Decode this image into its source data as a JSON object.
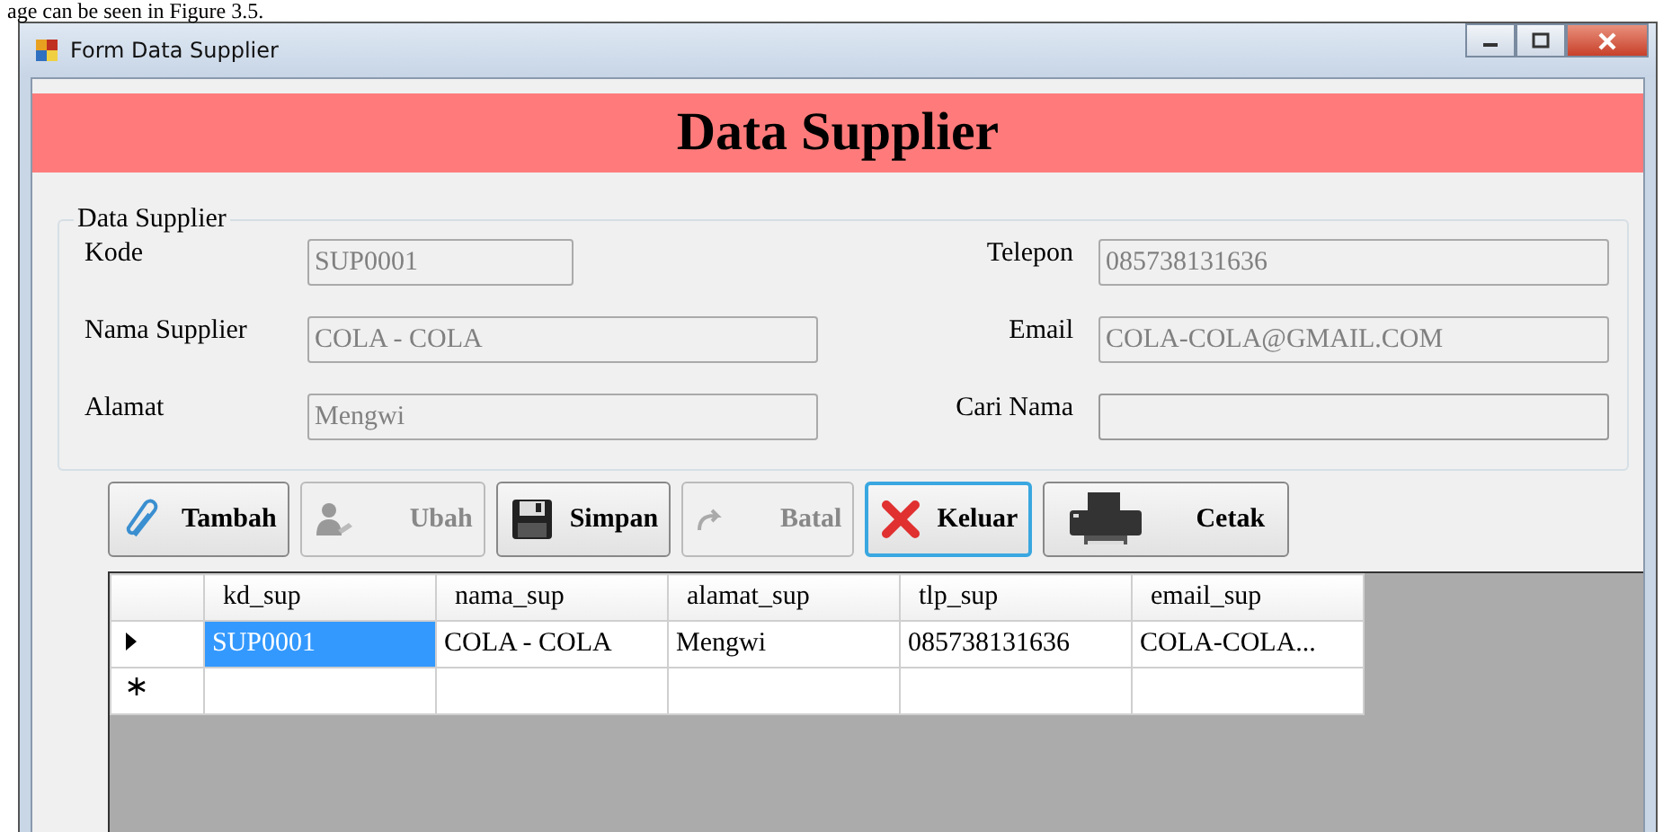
{
  "caption": "age can be seen in Figure 3.5.",
  "window": {
    "title": "Form Data Supplier"
  },
  "banner": {
    "title": "Data Supplier"
  },
  "group": {
    "title": "Data Supplier",
    "left_fields": [
      {
        "label": "Kode",
        "value": "SUP0001",
        "disabled": true
      },
      {
        "label": "Nama Supplier",
        "value": "COLA - COLA",
        "disabled": true
      },
      {
        "label": "Alamat",
        "value": "Mengwi",
        "disabled": true
      }
    ],
    "right_fields": [
      {
        "label": "Telepon",
        "value": "085738131636",
        "disabled": true
      },
      {
        "label": "Email",
        "value": "COLA-COLA@GMAIL.COM",
        "disabled": true
      },
      {
        "label": "Cari Nama",
        "disabled": false
      }
    ]
  },
  "buttons": [
    {
      "kind": "paperclip",
      "label": "Tambah",
      "disabled": false,
      "focused": false
    },
    {
      "kind": "person",
      "label": "Ubah",
      "disabled": true,
      "focused": false
    },
    {
      "kind": "floppy",
      "label": "Simpan",
      "disabled": false,
      "focused": false
    },
    {
      "kind": "arrow",
      "label": "Batal",
      "disabled": true,
      "focused": false
    },
    {
      "kind": "cross",
      "label": "Keluar",
      "disabled": false,
      "focused": true
    },
    {
      "kind": "printer",
      "label": "Cetak",
      "disabled": false,
      "focused": false
    }
  ],
  "grid": {
    "columns": [
      "kd_sup",
      "nama_sup",
      "alamat_sup",
      "tlp_sup",
      "email_sup"
    ],
    "rows": [
      {
        "kind": "current",
        "cells": [
          {
            "text": "SUP0001",
            "selected": true
          },
          {
            "text": "COLA - COLA",
            "selected": false
          },
          {
            "text": "Mengwi",
            "selected": false
          },
          {
            "text": "085738131636",
            "selected": false
          },
          {
            "text": "COLA-COLA...",
            "selected": false
          }
        ]
      },
      {
        "kind": "new",
        "cells": [
          {
            "selected": false
          },
          {
            "selected": false
          },
          {
            "selected": false
          },
          {
            "selected": false
          },
          {
            "selected": false
          }
        ]
      }
    ]
  }
}
